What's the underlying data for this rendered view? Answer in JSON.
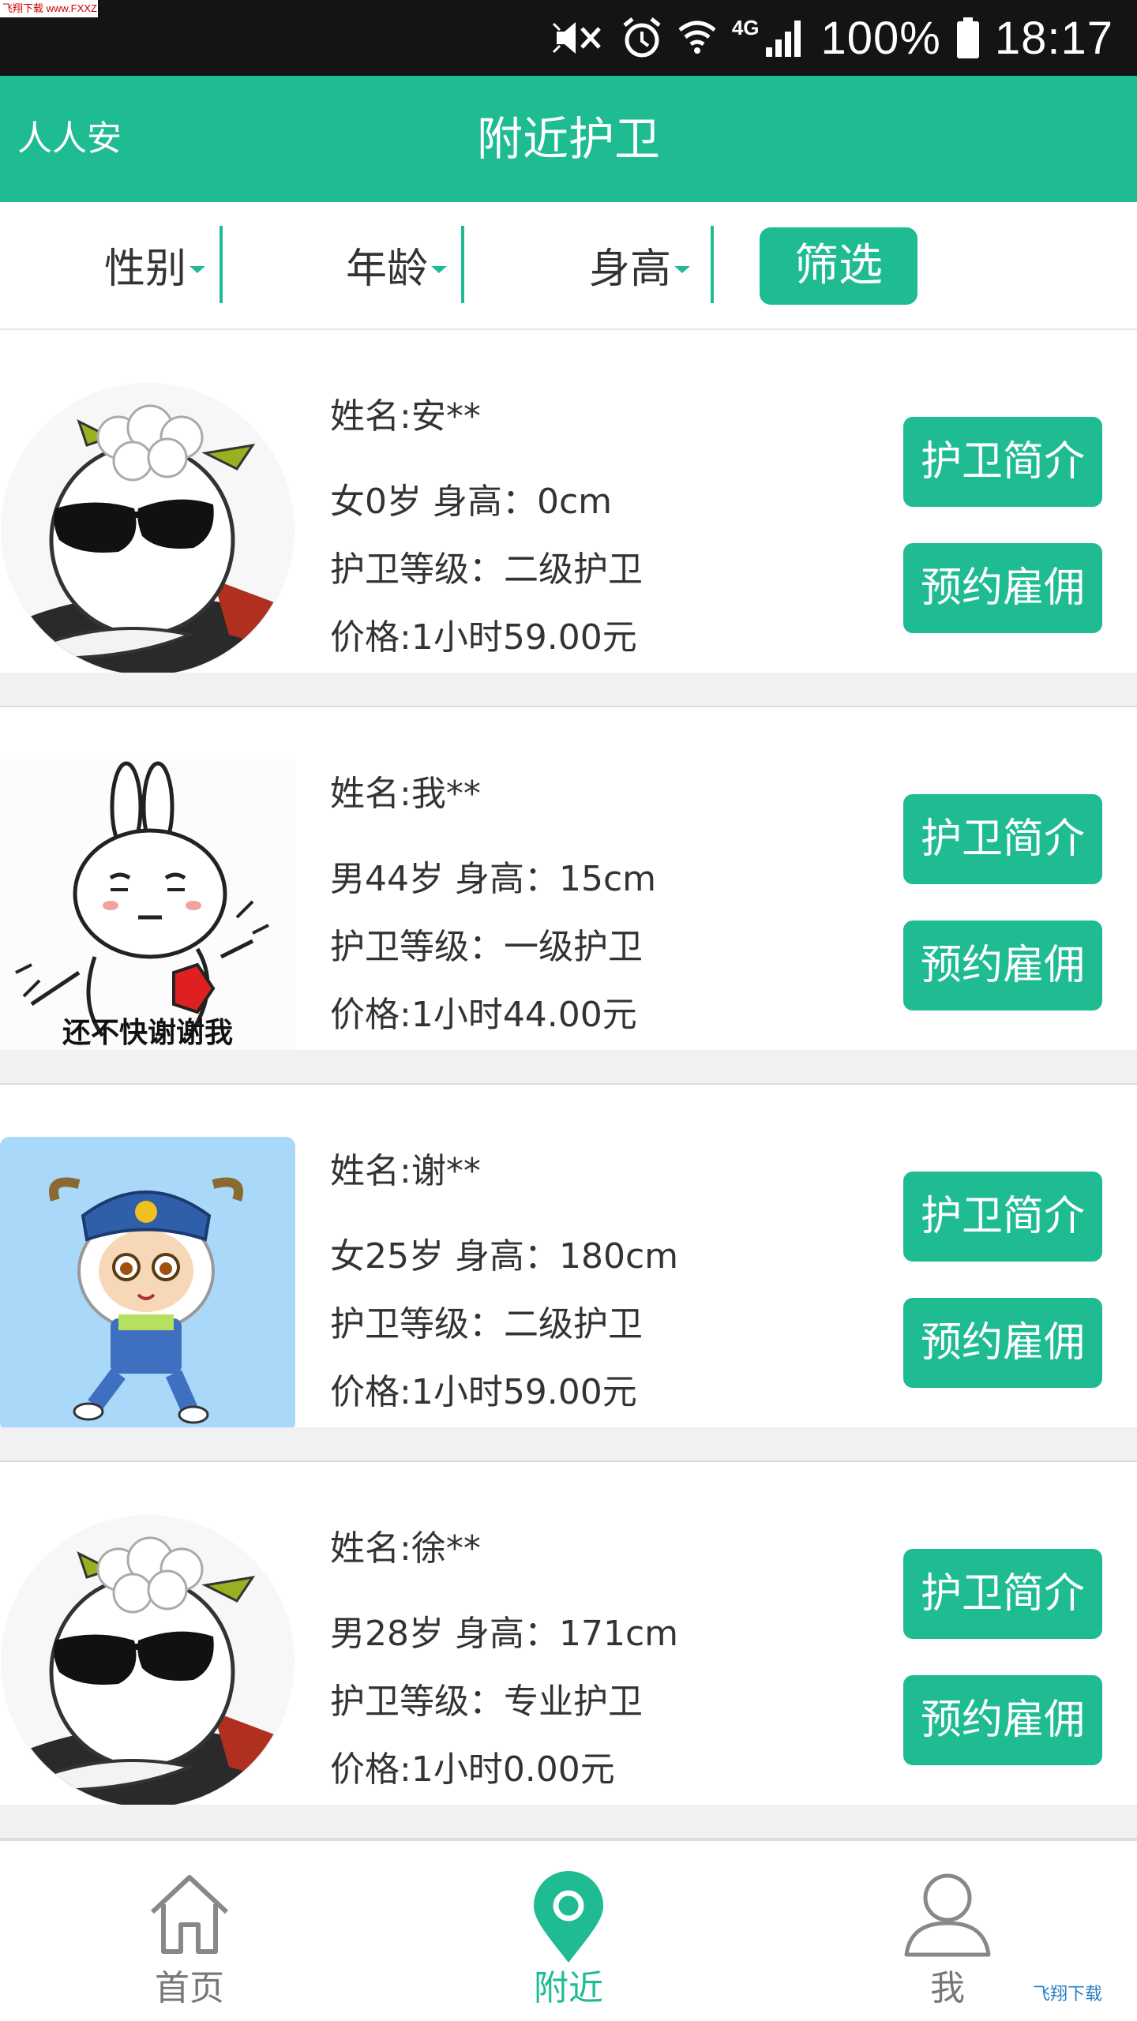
{
  "watermark": "飞翔下载 www.FXXZ.com",
  "status_bar": {
    "network": "4G",
    "battery": "100%",
    "time": "18:17"
  },
  "header": {
    "brand": "人人安",
    "title": "附近护卫"
  },
  "filters": {
    "gender": "性别",
    "age": "年龄",
    "height": "身高",
    "button": "筛选"
  },
  "guards": [
    {
      "name": "姓名:安**",
      "basic": "女0岁  身高：0cm",
      "level": "护卫等级：二级护卫",
      "price": "价格:1小时59.00元",
      "intro_label": "护卫简介",
      "hire_label": "预约雇佣"
    },
    {
      "name": "姓名:我**",
      "basic": "男44岁  身高：15cm",
      "level": "护卫等级：一级护卫",
      "price": "价格:1小时44.00元",
      "intro_label": "护卫简介",
      "hire_label": "预约雇佣",
      "avatar_caption": "还不快谢谢我"
    },
    {
      "name": "姓名:谢**",
      "basic": "女25岁  身高：180cm",
      "level": "护卫等级：二级护卫",
      "price": "价格:1小时59.00元",
      "intro_label": "护卫简介",
      "hire_label": "预约雇佣"
    },
    {
      "name": "姓名:徐**",
      "basic": "男28岁  身高：171cm",
      "level": "护卫等级：专业护卫",
      "price": "价格:1小时0.00元",
      "intro_label": "护卫简介",
      "hire_label": "预约雇佣"
    }
  ],
  "tabs": [
    {
      "label": "首页",
      "icon": "home-icon",
      "active": false
    },
    {
      "label": "附近",
      "icon": "location-pin-icon",
      "active": true
    },
    {
      "label": "我",
      "icon": "person-icon",
      "active": false
    }
  ],
  "corner_watermark": "飞翔下载",
  "colors": {
    "accent": "#1fbb93",
    "status_bar": "#141414",
    "separator": "#f1f1f3"
  }
}
